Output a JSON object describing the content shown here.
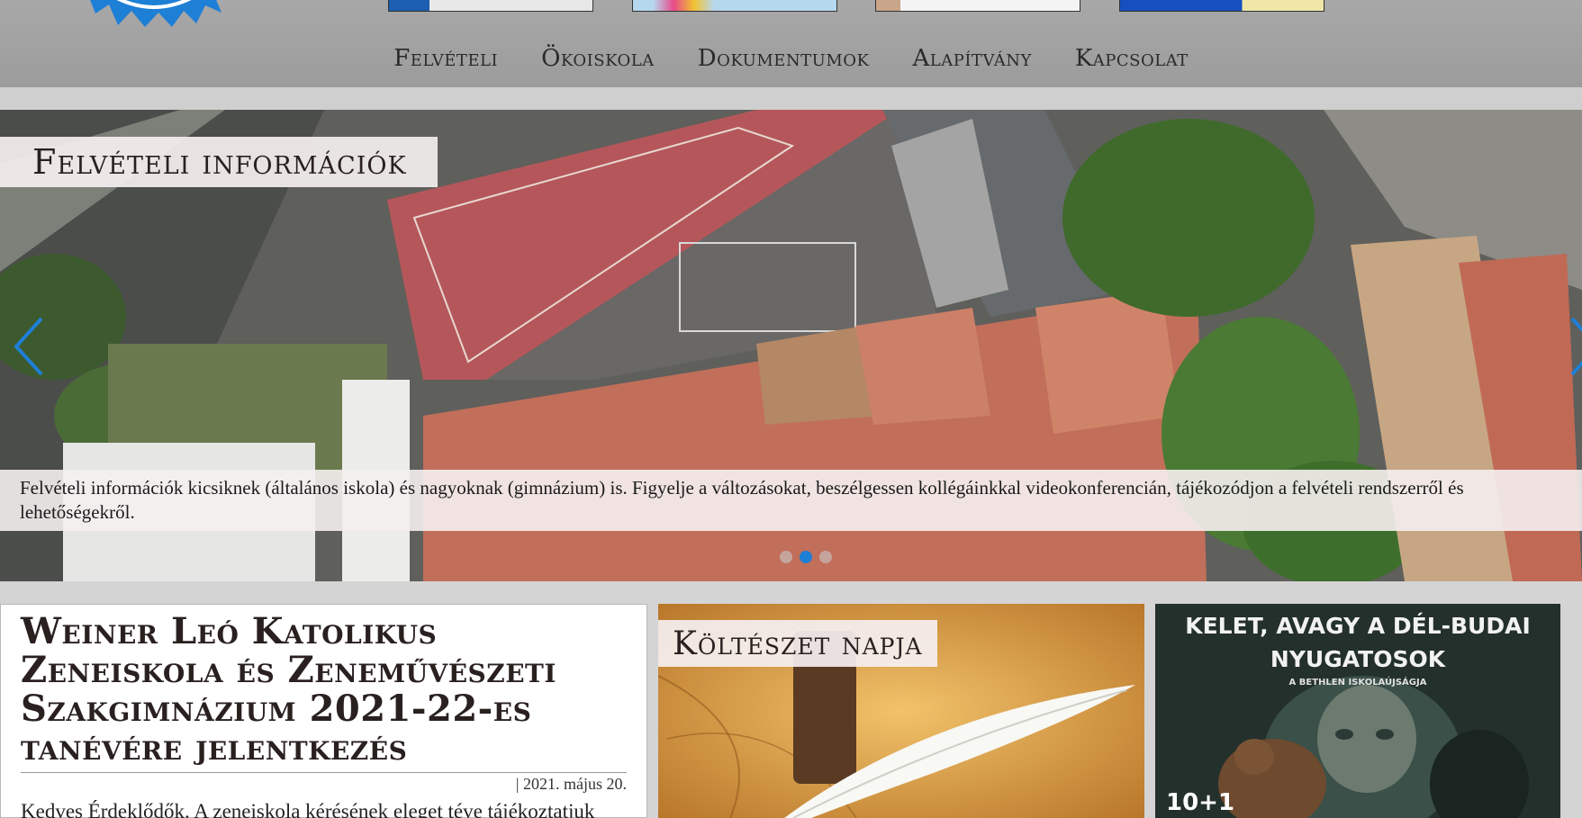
{
  "nav": {
    "items": [
      "Felvételi",
      "Ökoiskola",
      "Dokumentumok",
      "Alapítvány",
      "Kapcsolat"
    ]
  },
  "slider": {
    "title": "Felvételi információk",
    "caption": "Felvételi információk kicsiknek (általános iskola) és nagyoknak (gimnázium) is. Figyelje a változásokat, beszélgessen kollégáinkkal videokonferencián, tájékozódjon a felvételi rendszerről és lehetőségekről.",
    "dots": 3,
    "active_dot": 1
  },
  "news": {
    "title": "Weiner Leó Katolikus Zeneiskola és Zeneművészeti Szakgimnázium 2021-22-es tanévére jelentkezés",
    "meta": "| 2021. május 20.",
    "body": "Kedves Érdeklődők. A zeneiskola kérésének eleget téve tájékoztatjuk Önöket a következő tanévre való beiratkozás feltételeiről."
  },
  "poetry": {
    "title": "Költészet napja"
  },
  "poster": {
    "title": "KELET, AVAGY A DÉL-BUDAI NYUGATOSOK",
    "subtitle": "A BETHLEN ISKOLAÚJSÁGJA",
    "corner": "10+1"
  },
  "colors": {
    "header_bg": "#a4a4a4",
    "accent": "#1e7fd6",
    "text": "#2a2020"
  },
  "icons": {
    "arrow_left": "chevron-left-icon",
    "arrow_right": "chevron-right-icon",
    "logo": "school-logo"
  }
}
